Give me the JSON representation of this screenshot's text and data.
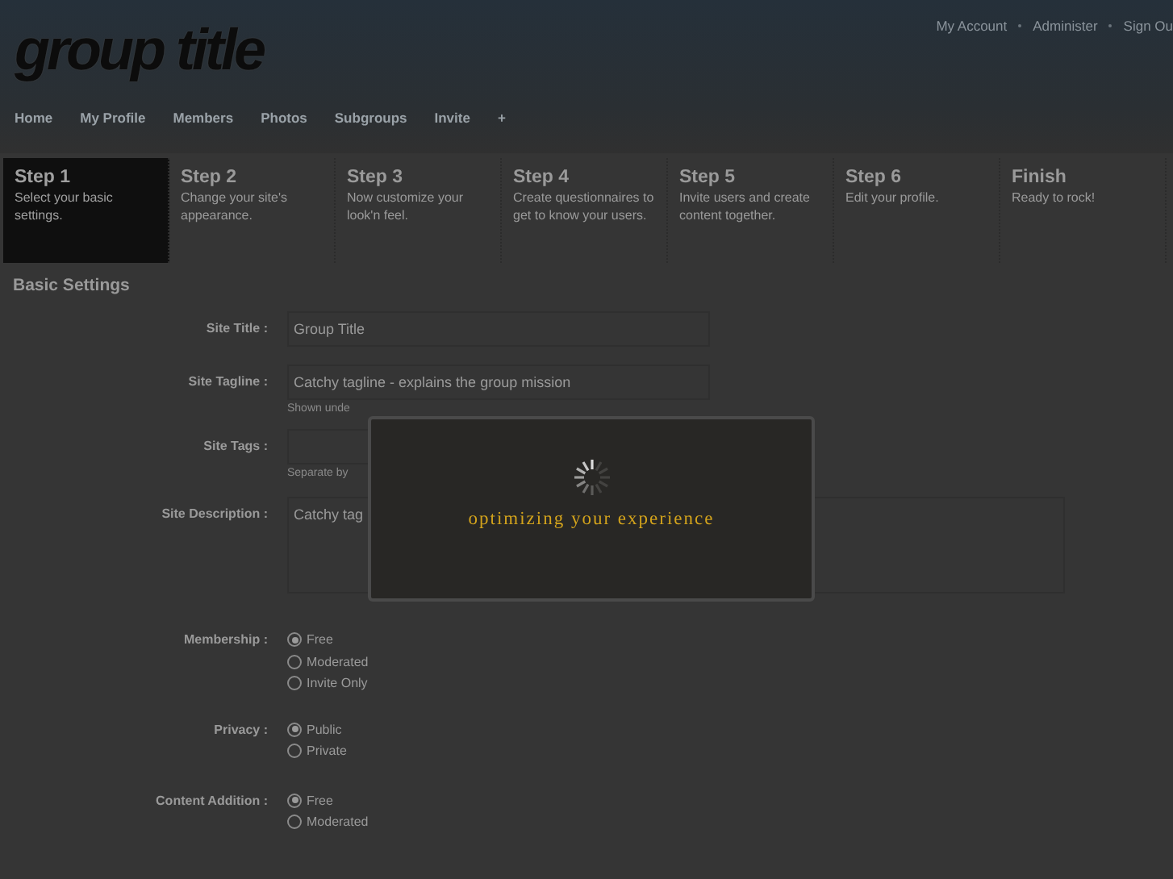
{
  "header": {
    "title": "group title",
    "account_links": [
      "My Account",
      "Administer",
      "Sign Ou"
    ]
  },
  "nav": {
    "items": [
      "Home",
      "My Profile",
      "Members",
      "Photos",
      "Subgroups",
      "Invite",
      "+"
    ]
  },
  "steps": [
    {
      "title": "Step 1",
      "description": "Select your basic settings.",
      "selected": true
    },
    {
      "title": "Step 2",
      "description": "Change your site's appearance.",
      "selected": false
    },
    {
      "title": "Step 3",
      "description": "Now customize your look'n feel.",
      "selected": false
    },
    {
      "title": "Step 4",
      "description": "Create questionnaires to get to know your users.",
      "selected": false
    },
    {
      "title": "Step 5",
      "description": "Invite users and create content together.",
      "selected": false
    },
    {
      "title": "Step 6",
      "description": "Edit your profile.",
      "selected": false
    },
    {
      "title": "Finish",
      "description": "Ready to rock!",
      "selected": false
    }
  ],
  "section": {
    "title": "Basic Settings"
  },
  "fields": [
    {
      "kind": "text",
      "label": "Site Title :",
      "value": "Group Title"
    },
    {
      "kind": "text",
      "label": "Site Tagline :",
      "value": "Catchy tagline - explains the group mission",
      "hint": "Shown unde"
    },
    {
      "kind": "text",
      "label": "Site Tags :",
      "hint": "Separate by"
    },
    {
      "kind": "textarea",
      "label": "Site Description :",
      "value": "Catchy tag"
    },
    {
      "kind": "radio",
      "label": "Membership :",
      "options": [
        {
          "label": "Free",
          "selected": true
        },
        {
          "label": "Moderated",
          "selected": false
        },
        {
          "label": "Invite Only",
          "selected": false
        }
      ]
    },
    {
      "kind": "radio",
      "label": "Privacy :",
      "options": [
        {
          "label": "Public",
          "selected": true
        },
        {
          "label": "Private",
          "selected": false
        }
      ]
    },
    {
      "kind": "radio",
      "label": "Content Addition :",
      "options": [
        {
          "label": "Free",
          "selected": true
        },
        {
          "label": "Moderated",
          "selected": false
        }
      ]
    }
  ],
  "modal": {
    "message": "optimizing your experience"
  }
}
